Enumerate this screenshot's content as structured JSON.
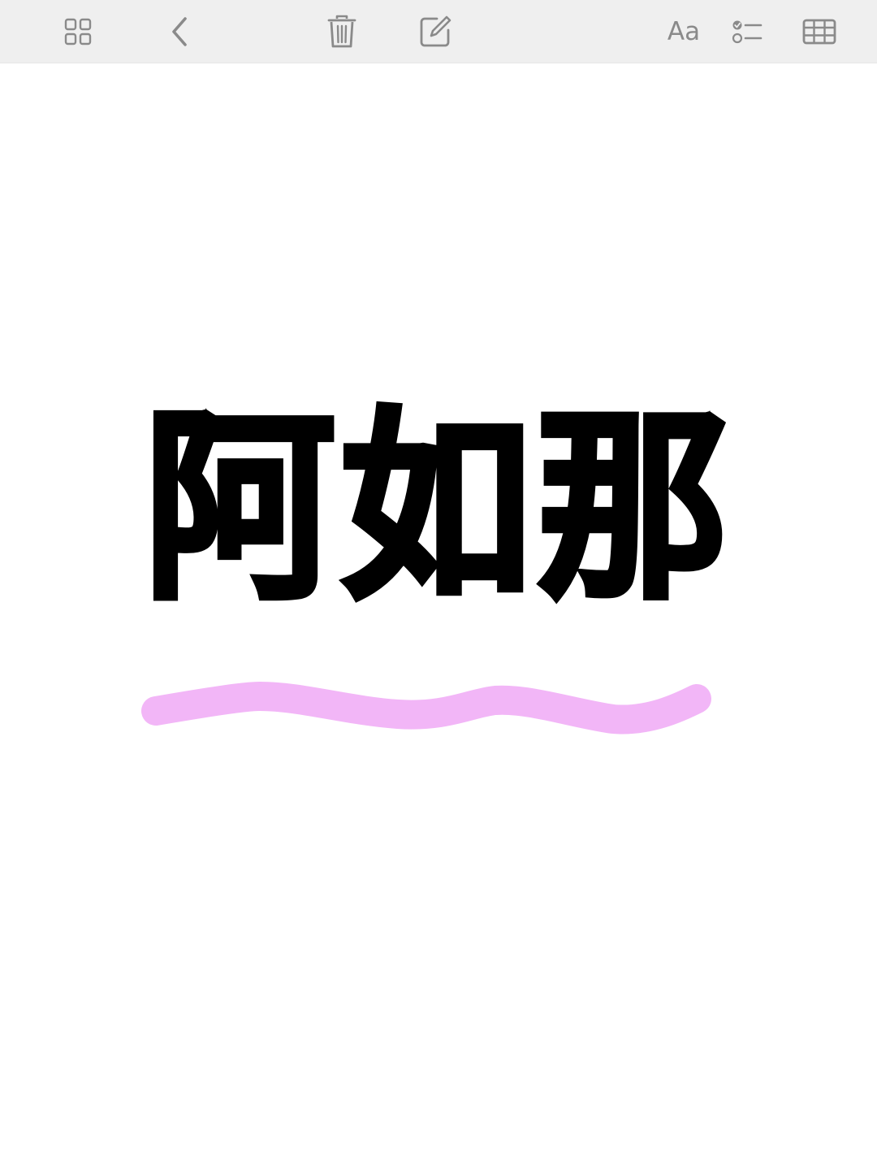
{
  "toolbar": {
    "buttons": [
      {
        "name": "gallery-view-button",
        "icon": "grid-icon"
      },
      {
        "name": "back-button",
        "icon": "chevron-left-icon"
      },
      {
        "name": "delete-button",
        "icon": "trash-icon"
      },
      {
        "name": "compose-button",
        "icon": "compose-icon"
      },
      {
        "name": "text-format-button",
        "icon": "text-format-icon",
        "label": "Aa"
      },
      {
        "name": "checklist-button",
        "icon": "checklist-icon"
      },
      {
        "name": "table-button",
        "icon": "table-icon"
      }
    ],
    "background": "#efefef",
    "icon_color": "#8a8a8a"
  },
  "note": {
    "headline": "阿如那",
    "headline_color": "#000000",
    "underline_color": "#f2b6f7"
  }
}
